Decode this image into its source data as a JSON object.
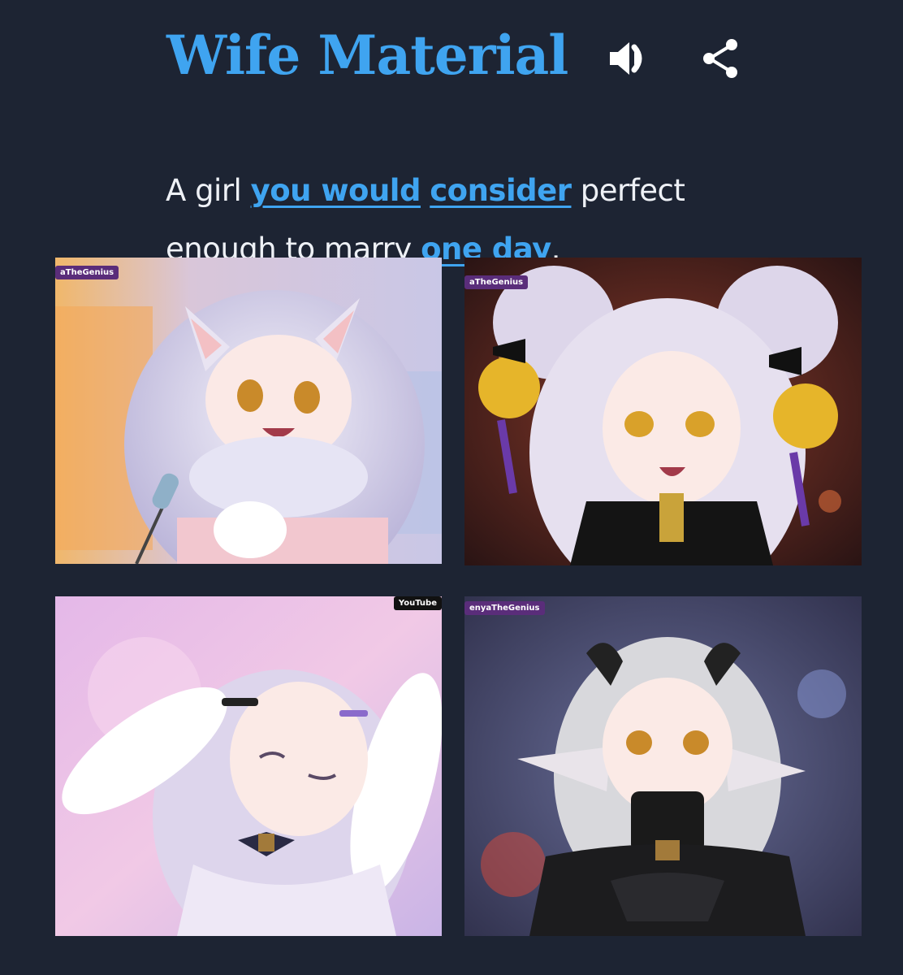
{
  "header": {
    "title": "Wife Material",
    "speaker_icon": "speaker-volume-icon",
    "share_icon": "share-icon"
  },
  "definition": {
    "part1": "A girl ",
    "link1": "you would",
    "space1": " ",
    "link2": "consider",
    "part2": " perfect enough to marry ",
    "link3": "one day",
    "part3": "."
  },
  "images": [
    {
      "id": "image-1",
      "watermark": "aTheGenius"
    },
    {
      "id": "image-2",
      "watermark": "aTheGenius"
    },
    {
      "id": "image-3",
      "watermark": "YouTube"
    },
    {
      "id": "image-4",
      "watermark": "enyaTheGenius"
    }
  ],
  "colors": {
    "background": "#1d2433",
    "accent": "#3fa4f0",
    "text": "#eef1f6"
  }
}
